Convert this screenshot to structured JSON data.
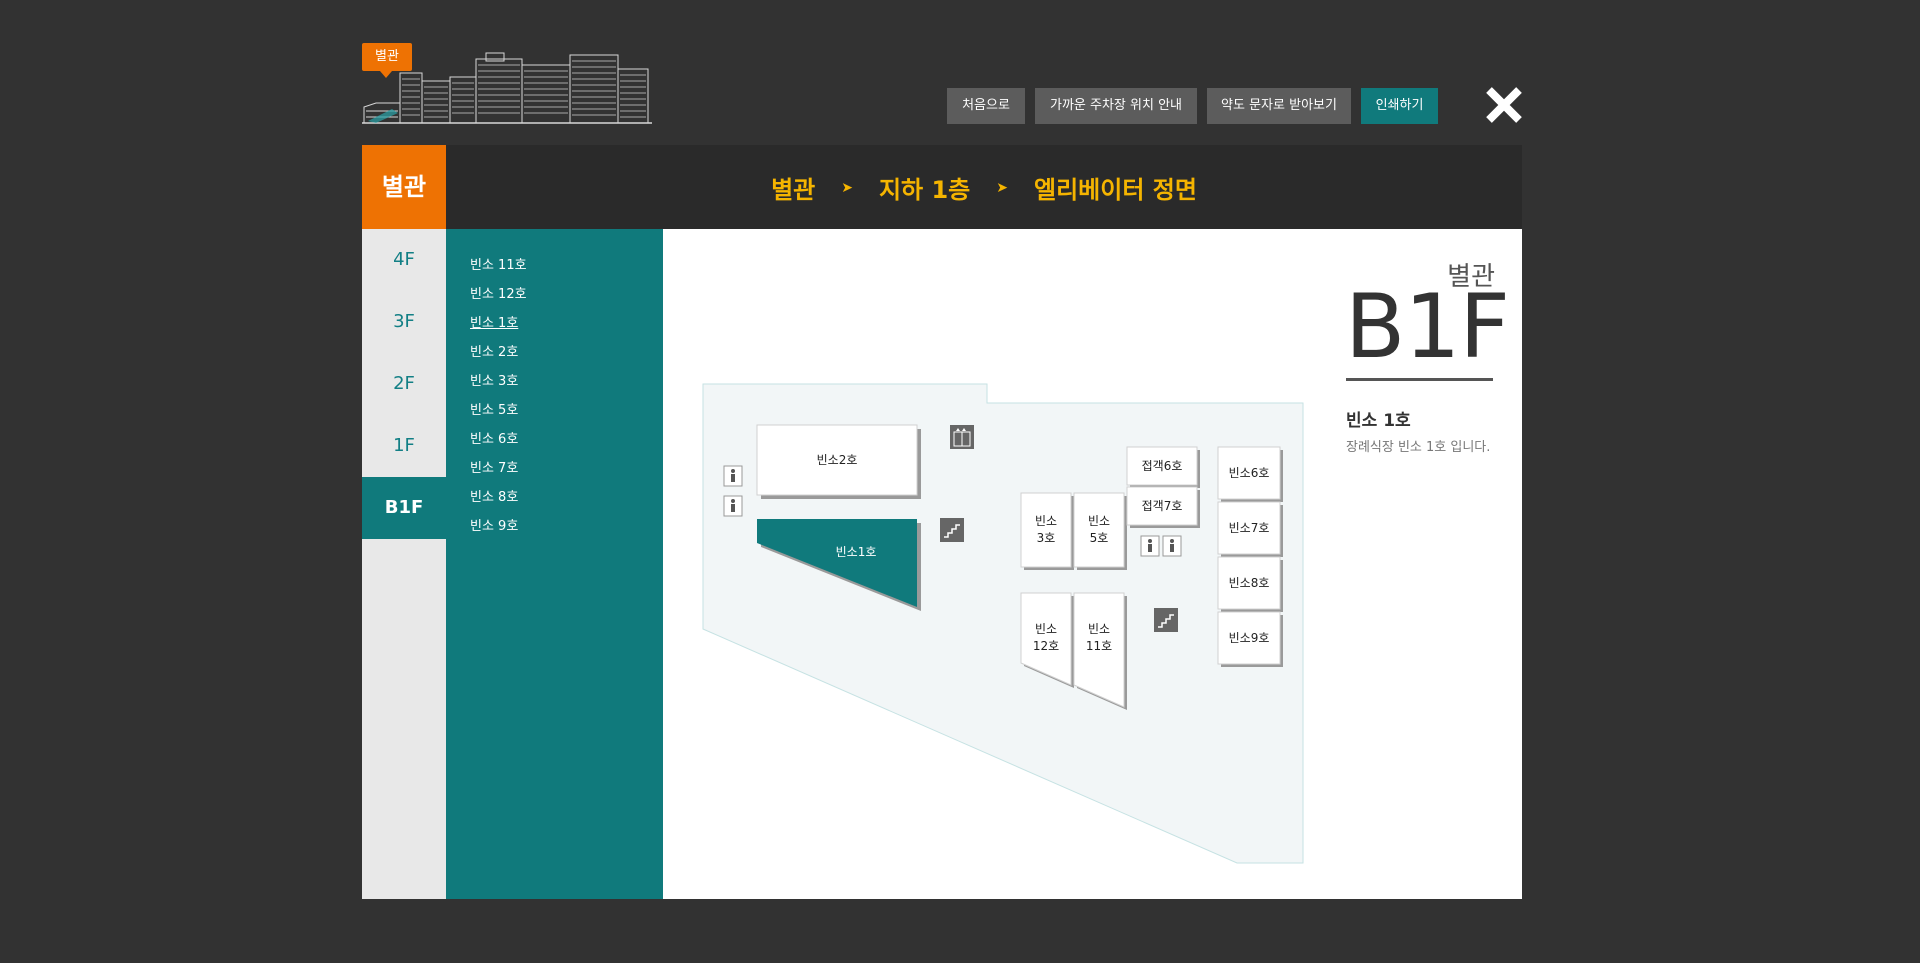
{
  "header": {
    "building_badge": "별관",
    "buttons": {
      "home": "처음으로",
      "parking": "가까운 주차장 위치 안내",
      "sms": "약도 문자로 받아보기",
      "print": "인쇄하기"
    }
  },
  "sidebar": {
    "title": "별관",
    "floors": [
      "4F",
      "3F",
      "2F",
      "1F",
      "B1F"
    ],
    "active_floor": "B1F"
  },
  "breadcrumb": {
    "building": "별관",
    "floor": "지하 1층",
    "location": "엘리베이터 정면",
    "separator": "➤"
  },
  "rooms": [
    "빈소 11호",
    "빈소 12호",
    "빈소 1호",
    "빈소 2호",
    "빈소 3호",
    "빈소 5호",
    "빈소 6호",
    "빈소 7호",
    "빈소 8호",
    "빈소 9호"
  ],
  "active_room": "빈소 1호",
  "map": {
    "labels": {
      "room2": "빈소2호",
      "room1": "빈소1호",
      "room3_line1": "빈소",
      "room3_line2": "3호",
      "room5_line1": "빈소",
      "room5_line2": "5호",
      "room12_line1": "빈소",
      "room12_line2": "12호",
      "room11_line1": "빈소",
      "room11_line2": "11호",
      "reception6": "접객6호",
      "reception7": "접객7호",
      "room6": "빈소6호",
      "room7": "빈소7호",
      "room8": "빈소8호",
      "room9": "빈소9호"
    },
    "icons": [
      "elevator-icon",
      "stairs-icon",
      "restroom-icon"
    ],
    "highlight_color": "#107a7c",
    "floor_color": "#f2f6f7"
  },
  "info": {
    "building": "별관",
    "floor": "B1F",
    "room_title": "빈소 1호",
    "description": "장례식장 빈소 1호 입니다."
  },
  "colors": {
    "accent_orange": "#ee7203",
    "accent_teal": "#107a7c",
    "breadcrumb_yellow": "#f5b400",
    "background": "#323232"
  }
}
